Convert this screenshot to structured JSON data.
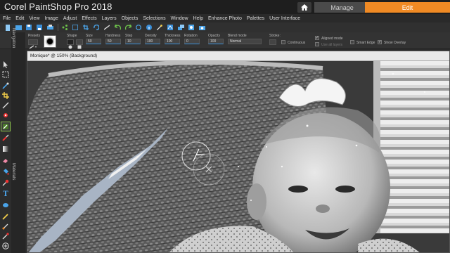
{
  "app": {
    "title": "Corel PaintShop Pro 2018",
    "tabs": {
      "manage": "Manage",
      "edit": "Edit"
    }
  },
  "menu": [
    "File",
    "Edit",
    "View",
    "Image",
    "Adjust",
    "Effects",
    "Layers",
    "Objects",
    "Selections",
    "Window",
    "Help",
    "Enhance Photo",
    "Palettes",
    "User Interface"
  ],
  "options": {
    "presets_label": "Presets",
    "shape_label": "Shape",
    "size_label": "Size",
    "size_value": "50",
    "hardness_label": "Hardness",
    "hardness_value": "50",
    "step_label": "Step",
    "step_value": "10",
    "density_label": "Density",
    "density_value": "100",
    "thickness_label": "Thickness",
    "thickness_value": "100",
    "rotation_label": "Rotation",
    "rotation_value": "0",
    "opacity_label": "Opacity",
    "opacity_value": "100",
    "blend_label": "Blend mode",
    "blend_value": "Normal",
    "stroke_label": "Stroke:",
    "continuous_label": "Continuous",
    "aligned_label": "Aligned mode",
    "use_all_layers_label": "Use all layers",
    "smart_edge_label": "Smart Edge",
    "show_overlay_label": "Show Overlay",
    "aligned_checked": true,
    "show_overlay_checked": true
  },
  "side_panel": {
    "navigation_label": "Navigation",
    "materials_label": "Materials"
  },
  "document": {
    "title": "Monique* @ 150% (Background)"
  },
  "colors": {
    "accent": "#f08a24",
    "active_tool_outline": "#8bc34a"
  }
}
